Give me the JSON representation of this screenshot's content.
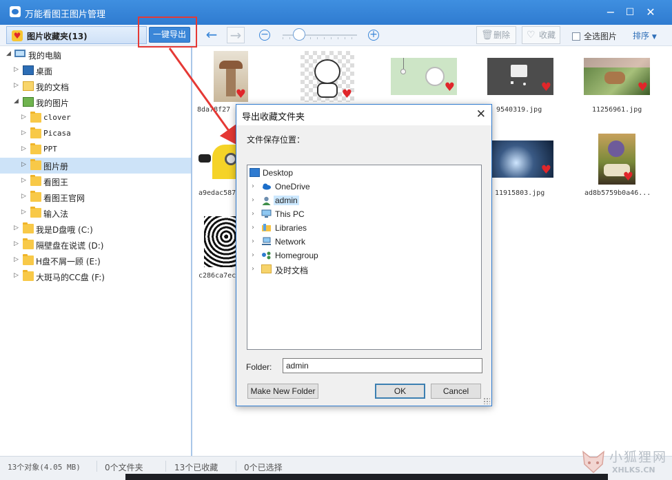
{
  "window": {
    "title": "万能看图王图片管理",
    "controls": {
      "minimize": "−",
      "maximize": "☐",
      "close": "✕"
    }
  },
  "toolbar": {
    "favorites_label": "图片收藏夹(13)",
    "export_label": "一键导出",
    "back": "←",
    "forward": "→",
    "zoom_out": "−",
    "zoom_in": "+",
    "zoom_level": 0.2,
    "delete_label": "删除",
    "favorite_label": "收藏",
    "select_all_label": "全选图片",
    "sort_label": "排序"
  },
  "sidebar": {
    "items": [
      {
        "label": "我的电脑",
        "icon": "computer-icon",
        "expanded": true
      },
      {
        "label": "桌面",
        "icon": "desktop-icon"
      },
      {
        "label": "我的文档",
        "icon": "documents-icon"
      },
      {
        "label": "我的图片",
        "icon": "pictures-icon",
        "expanded": true
      },
      {
        "label": "clover",
        "icon": "folder-icon"
      },
      {
        "label": "Picasa",
        "icon": "folder-icon"
      },
      {
        "label": "PPT",
        "icon": "folder-icon"
      },
      {
        "label": "图片册",
        "icon": "folder-icon",
        "selected": true
      },
      {
        "label": "看图王",
        "icon": "folder-icon"
      },
      {
        "label": "看图王官网",
        "icon": "folder-icon"
      },
      {
        "label": "输入法",
        "icon": "folder-icon"
      },
      {
        "label": "我是D盘哦 (C:)",
        "icon": "folder-icon"
      },
      {
        "label": "隔壁盘在说谎 (D:)",
        "icon": "folder-icon"
      },
      {
        "label": "H盘不屑一顾 (E:)",
        "icon": "folder-icon"
      },
      {
        "label": "大斑马的CC盘 (F:)",
        "icon": "folder-icon"
      }
    ]
  },
  "thumbnails": [
    {
      "caption": "8da78f27"
    },
    {
      "caption": ""
    },
    {
      "caption": ""
    },
    {
      "caption": "9540319.jpg"
    },
    {
      "caption": "11256961.jpg"
    },
    {
      "caption": "a9edac587"
    },
    {
      "caption": "11915803.jpg"
    },
    {
      "caption": "ad8b5759b0a46..."
    },
    {
      "caption": "c286ca7ec"
    }
  ],
  "dialog": {
    "title": "导出收藏文件夹",
    "close": "✕",
    "prompt": "文件保存位置：",
    "tree": [
      {
        "label": "Desktop",
        "icon": "desktop-icon"
      },
      {
        "label": "OneDrive",
        "icon": "onedrive-icon"
      },
      {
        "label": "admin",
        "icon": "user-icon",
        "selected": true
      },
      {
        "label": "This PC",
        "icon": "computer-icon"
      },
      {
        "label": "Libraries",
        "icon": "libraries-icon"
      },
      {
        "label": "Network",
        "icon": "network-icon"
      },
      {
        "label": "Homegroup",
        "icon": "homegroup-icon"
      },
      {
        "label": "及时文档",
        "icon": "folder-icon"
      }
    ],
    "folder_label": "Folder:",
    "folder_value": "admin",
    "make_folder_label": "Make New Folder",
    "ok_label": "OK",
    "cancel_label": "Cancel"
  },
  "status": {
    "objects": "13个对象(4.05 MB)",
    "folders": "0个文件夹",
    "favorited": "13个已收藏",
    "selected": "0个已选择"
  },
  "watermark": {
    "title": "小狐狸网",
    "sub": "XHLKS.CN"
  },
  "colors": {
    "accent": "#2f7bd0",
    "highlight": "#e53935",
    "heart": "#e0262a"
  }
}
